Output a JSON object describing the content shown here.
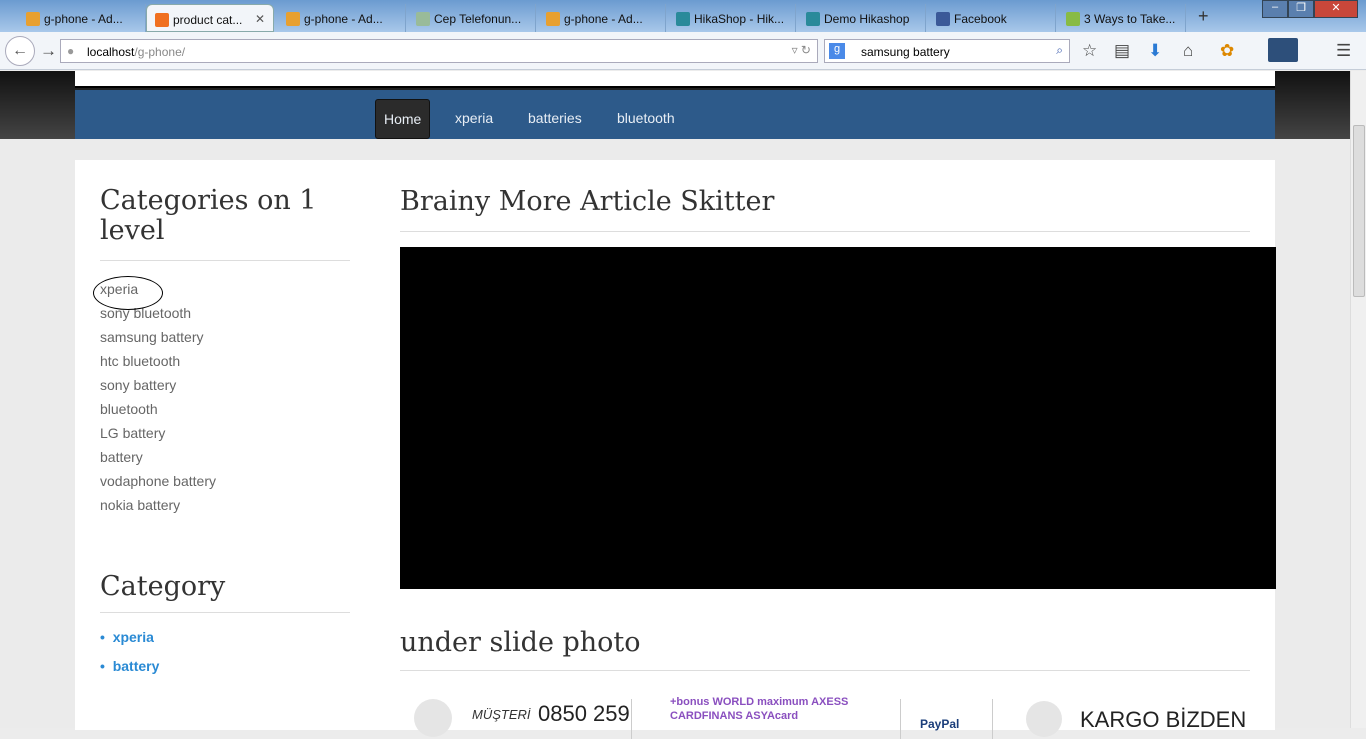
{
  "browser": {
    "tabs": [
      "g-phone - Ad...",
      "product cat...",
      "g-phone - Ad...",
      "Cep Telefonun...",
      "g-phone - Ad...",
      "HikaShop - Hik...",
      "Demo Hikashop",
      "Facebook",
      "3 Ways to Take..."
    ],
    "url_host": "localhost",
    "url_path": "/g-phone/",
    "search_value": "samsung battery"
  },
  "menu": [
    "Home",
    "xperia",
    "batteries",
    "bluetooth"
  ],
  "sidebar": {
    "title": "Categories on 1 level",
    "items": [
      "xperia",
      "sony bluetooth",
      "samsung battery",
      "htc bluetooth",
      "sony battery",
      "bluetooth",
      "LG battery",
      "battery",
      "vodaphone battery",
      "nokia battery"
    ],
    "category_title": "Category",
    "category_items": [
      "xperia",
      "battery"
    ]
  },
  "main": {
    "title": "Brainy More Article Skitter",
    "section2": "under slide photo",
    "banner": {
      "musteri": "MÜŞTERİ",
      "phone": "0850 259",
      "cards": "+bonus WORLD maximum AXESS CARDFINANS ASYAcard",
      "paypal": "PayPal",
      "kargo": "KARGO BİZDEN"
    }
  }
}
